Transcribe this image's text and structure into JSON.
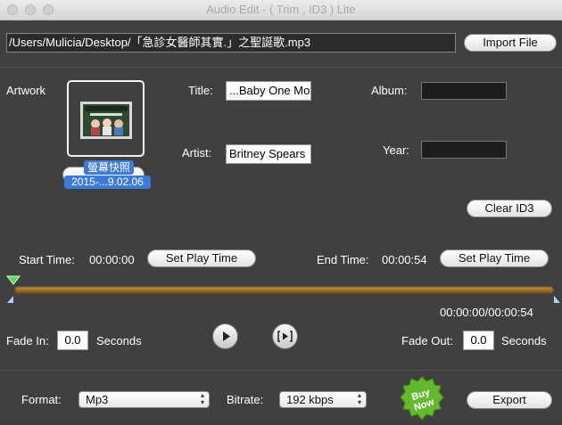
{
  "window": {
    "title": "Audio Edit - ( Trim , ID3 ) Lite"
  },
  "file": {
    "path": "/Users/Mulicia/Desktop/「急診女醫師其實.」之聖誕歌.mp3",
    "import_label": "Import File"
  },
  "artwork": {
    "label": "Artwork",
    "file_name_top": "螢幕快照",
    "file_name_bottom": "2015-...9.02.06"
  },
  "tags": {
    "title_label": "Title:",
    "title_value": "...Baby One Mo",
    "artist_label": "Artist:",
    "artist_value": "Britney Spears",
    "album_label": "Album:",
    "album_value": "",
    "year_label": "Year:",
    "year_value": "",
    "clear_label": "Clear ID3"
  },
  "trim": {
    "start_label": "Start Time:",
    "start_value": "00:00:00",
    "end_label": "End Time:",
    "end_value": "00:00:54",
    "set_play_time_label": "Set Play Time",
    "position_readout": "00:00:00/00:00:54"
  },
  "fade": {
    "in_label": "Fade In:",
    "in_value": "0.0",
    "out_label": "Fade Out:",
    "out_value": "0.0",
    "unit": "Seconds"
  },
  "playback": {
    "play_icon": "play-icon",
    "loop_icon": "play-selection-icon"
  },
  "output": {
    "format_label": "Format:",
    "format_value": "Mp3",
    "bitrate_label": "Bitrate:",
    "bitrate_value": "192 kbps",
    "buy_now_label": "Buy Now",
    "export_label": "Export"
  },
  "colors": {
    "background": "#404040",
    "track": "#b07c2e",
    "marker_green": "#5fd35b",
    "selection_blue": "#3e7ad7",
    "buy_green": "#62b92e"
  }
}
